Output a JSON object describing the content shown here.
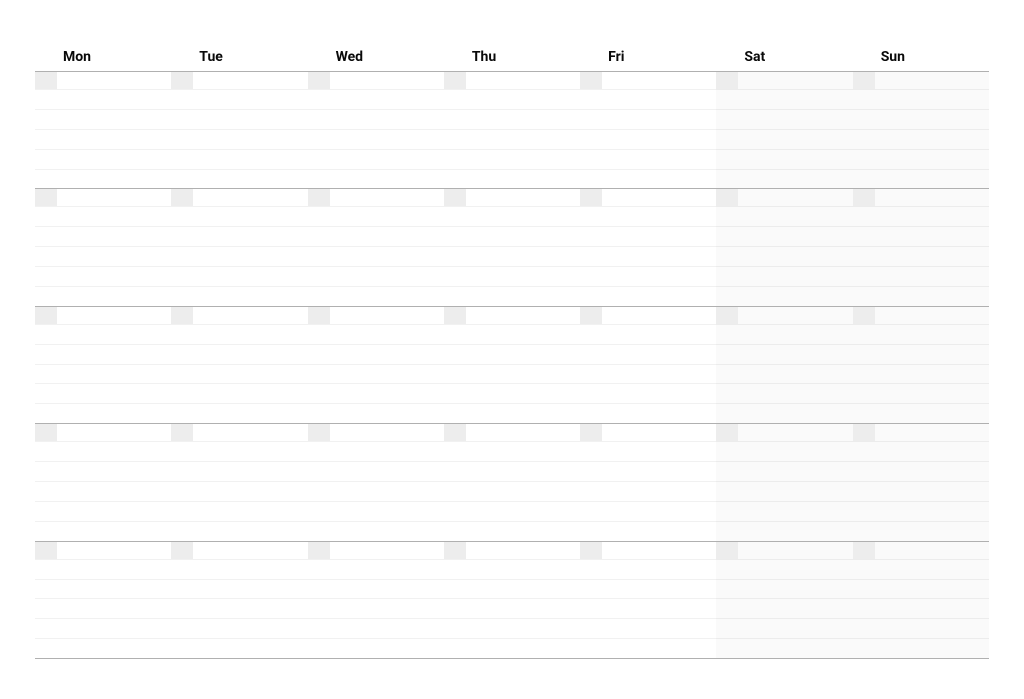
{
  "calendar": {
    "day_headers": [
      "Mon",
      "Tue",
      "Wed",
      "Thu",
      "Fri",
      "Sat",
      "Sun"
    ],
    "weekend_indices": [
      5,
      6
    ],
    "weeks": [
      {
        "days": [
          {
            "date": ""
          },
          {
            "date": ""
          },
          {
            "date": ""
          },
          {
            "date": ""
          },
          {
            "date": ""
          },
          {
            "date": ""
          },
          {
            "date": ""
          }
        ]
      },
      {
        "days": [
          {
            "date": ""
          },
          {
            "date": ""
          },
          {
            "date": ""
          },
          {
            "date": ""
          },
          {
            "date": ""
          },
          {
            "date": ""
          },
          {
            "date": ""
          }
        ]
      },
      {
        "days": [
          {
            "date": ""
          },
          {
            "date": ""
          },
          {
            "date": ""
          },
          {
            "date": ""
          },
          {
            "date": ""
          },
          {
            "date": ""
          },
          {
            "date": ""
          }
        ]
      },
      {
        "days": [
          {
            "date": ""
          },
          {
            "date": ""
          },
          {
            "date": ""
          },
          {
            "date": ""
          },
          {
            "date": ""
          },
          {
            "date": ""
          },
          {
            "date": ""
          }
        ]
      },
      {
        "days": [
          {
            "date": ""
          },
          {
            "date": ""
          },
          {
            "date": ""
          },
          {
            "date": ""
          },
          {
            "date": ""
          },
          {
            "date": ""
          },
          {
            "date": ""
          }
        ]
      }
    ],
    "rows_per_day": 4
  }
}
